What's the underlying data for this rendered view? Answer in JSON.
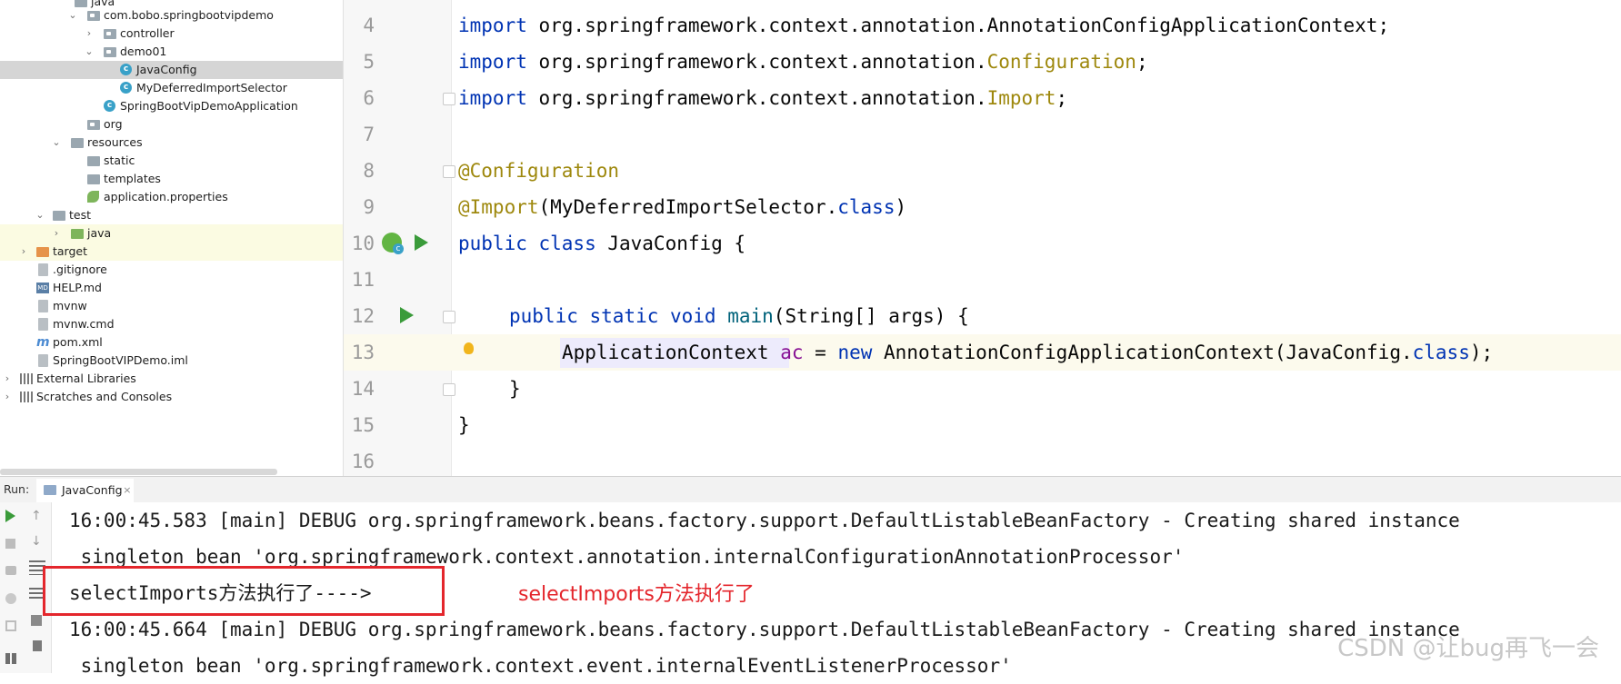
{
  "tree": {
    "items": [
      {
        "label": "java",
        "chevron": "",
        "icon": "folder"
      },
      {
        "label": "com.bobo.springbootvipdemo",
        "chevron": "v",
        "icon": "package"
      },
      {
        "label": "controller",
        "chevron": ">",
        "icon": "package"
      },
      {
        "label": "demo01",
        "chevron": "v",
        "icon": "package"
      },
      {
        "label": "JavaConfig",
        "chevron": "",
        "icon": "class"
      },
      {
        "label": "MyDeferredImportSelector",
        "chevron": "",
        "icon": "class"
      },
      {
        "label": "SpringBootVipDemoApplication",
        "chevron": "",
        "icon": "class"
      },
      {
        "label": "org",
        "chevron": "",
        "icon": "package"
      },
      {
        "label": "resources",
        "chevron": "v",
        "icon": "folder"
      },
      {
        "label": "static",
        "chevron": "",
        "icon": "folder"
      },
      {
        "label": "templates",
        "chevron": "",
        "icon": "folder"
      },
      {
        "label": "application.properties",
        "chevron": "",
        "icon": "leaf"
      },
      {
        "label": "test",
        "chevron": "v",
        "icon": "folder"
      },
      {
        "label": "java",
        "chevron": ">",
        "icon": "folder-green"
      },
      {
        "label": "target",
        "chevron": ">",
        "icon": "folder-orange"
      },
      {
        "label": ".gitignore",
        "chevron": "",
        "icon": "file"
      },
      {
        "label": "HELP.md",
        "chevron": "",
        "icon": "md"
      },
      {
        "label": "mvnw",
        "chevron": "",
        "icon": "file"
      },
      {
        "label": "mvnw.cmd",
        "chevron": "",
        "icon": "file"
      },
      {
        "label": "pom.xml",
        "chevron": "",
        "icon": "maven"
      },
      {
        "label": "SpringBootVIPDemo.iml",
        "chevron": "",
        "icon": "file"
      },
      {
        "label": "External Libraries",
        "chevron": ">",
        "icon": "library"
      },
      {
        "label": "Scratches and Consoles",
        "chevron": ">",
        "icon": "scratch"
      }
    ],
    "selected": "JavaConfig"
  },
  "editor": {
    "line_numbers": [
      "4",
      "5",
      "6",
      "7",
      "8",
      "9",
      "10",
      "11",
      "12",
      "13",
      "14",
      "15",
      "16"
    ],
    "lines": {
      "l4": {
        "kw": "import",
        "rest": " org.springframework.context.annotation.AnnotationConfigApplicationContext;"
      },
      "l5": {
        "kw": "import",
        "pre": " org.springframework.context.annotation.",
        "an": "Configuration",
        "end": ";"
      },
      "l6": {
        "kw": "import",
        "pre": " org.springframework.context.annotation.",
        "an": "Import",
        "end": ";"
      },
      "l8": {
        "an": "@Configuration"
      },
      "l9": {
        "an": "@Import",
        "pre": "(MyDeferredImportSelector.",
        "kw": "class",
        "end": ")"
      },
      "l10": {
        "kw": "public class",
        "rest": " JavaConfig {"
      },
      "l12": {
        "kw": "public static void",
        "fn": " main",
        "rest": "(String[] args) {"
      },
      "l13": {
        "t1": "ApplicationContext",
        "gr": " ac",
        "t2": " = ",
        "kw": "new",
        "t3": " AnnotationConfigApplicationContext(JavaConfig.",
        "kw2": "class",
        "t4": ");"
      },
      "l14": {
        "rest": "}"
      },
      "l15": {
        "rest": "}"
      }
    }
  },
  "run": {
    "label": "Run:",
    "tab": "JavaConfig",
    "tab_close": "×",
    "console": [
      "16:00:45.583 [main] DEBUG org.springframework.beans.factory.support.DefaultListableBeanFactory - Creating shared instance",
      " singleton bean 'org.springframework.context.annotation.internalConfigurationAnnotationProcessor'",
      "selectImports方法执行了---->",
      "16:00:45.664 [main] DEBUG org.springframework.beans.factory.support.DefaultListableBeanFactory - Creating shared instance",
      " singleton bean 'org.springframework.context.event.internalEventListenerProcessor'"
    ]
  },
  "annotation": {
    "text": "selectImports方法执行了",
    "color": "#e4262c"
  },
  "watermark": "CSDN @让bug再飞一会",
  "colors": {
    "keyword": "#0033b3",
    "annotation": "#9e880d",
    "method": "#00627a",
    "run": "#3a9b3a",
    "selection": "#d5d5d5"
  }
}
